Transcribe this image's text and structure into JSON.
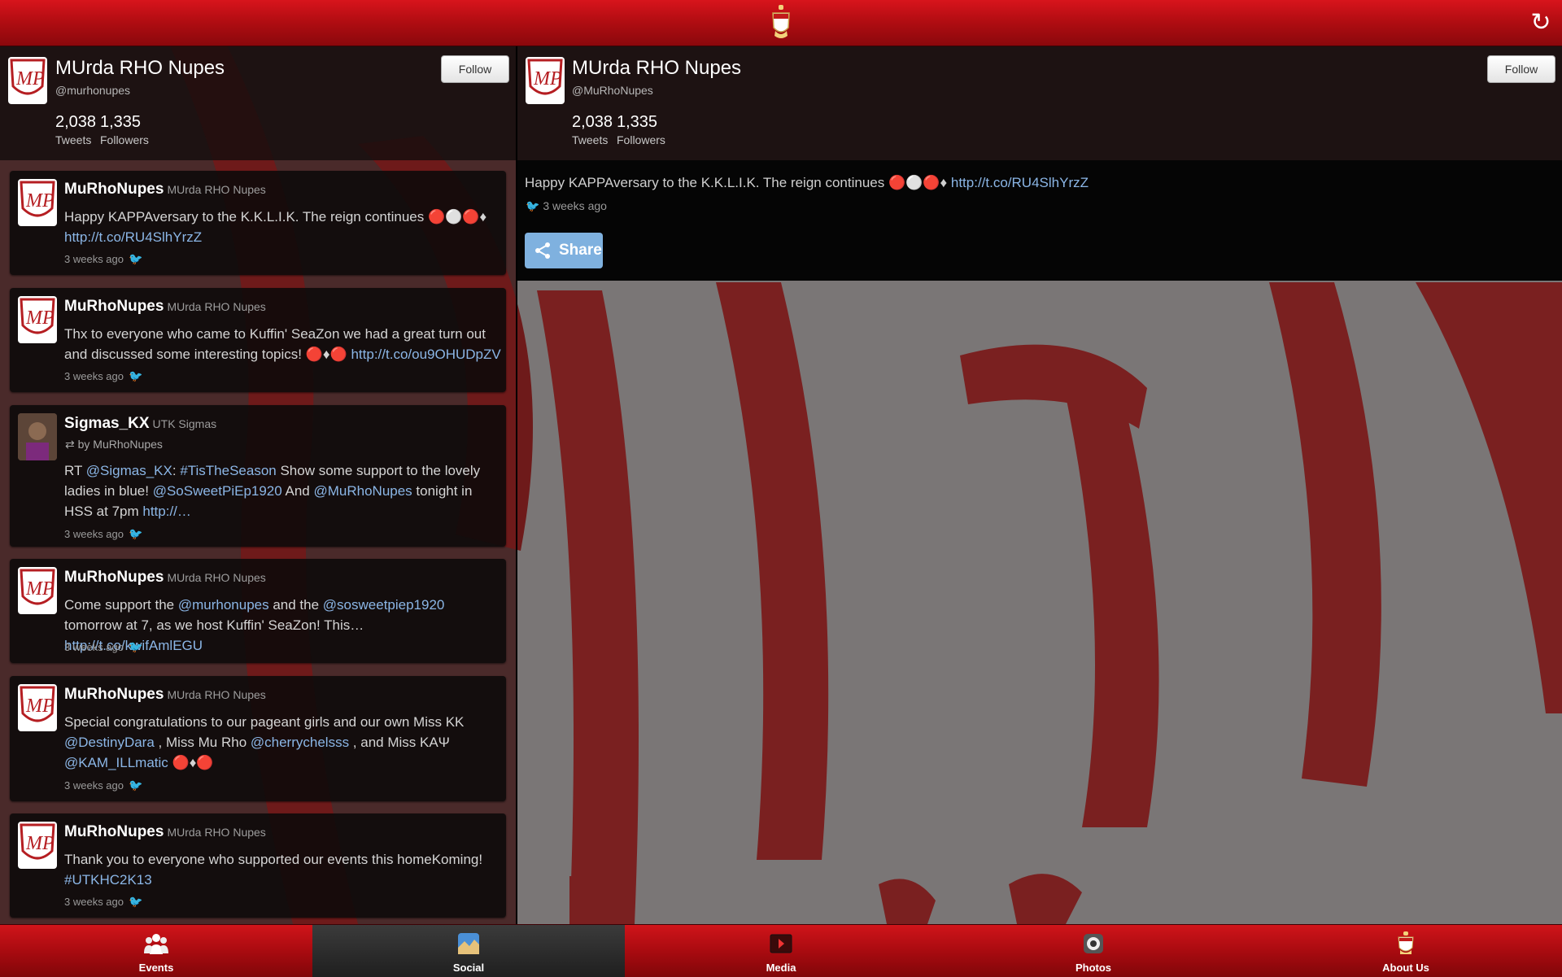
{
  "app": {
    "colors": {
      "primary": "#b30d12",
      "link": "#8bb6e6",
      "share": "#7fb1df"
    }
  },
  "topbar": {
    "logo_icon": "crest-logo-icon",
    "refresh_icon": "refresh-icon",
    "refresh_glyph": "↻"
  },
  "left_profile": {
    "name": "MUrda RHO Nupes",
    "handle": "@murhonupes",
    "tweets_count": "2,038",
    "tweets_label": "Tweets",
    "followers_count": "1,335",
    "followers_label": "Followers",
    "follow_label": "Follow"
  },
  "right_profile": {
    "name": "MUrda RHO Nupes",
    "handle": "@MuRhoNupes",
    "tweets_count": "2,038",
    "tweets_label": "Tweets",
    "followers_count": "1,335",
    "followers_label": "Followers",
    "follow_label": "Follow"
  },
  "tweets": [
    {
      "username": "MuRhoNupes",
      "display_name": "MUrda RHO Nupes",
      "text_before": "Happy KAPPAversary to the K.K.L.I.K. The reign continues 🔴⚪🔴♦",
      "link": "http://t.co/RU4SlhYrzZ",
      "text_after": "",
      "time": "3 weeks ago"
    },
    {
      "username": "MuRhoNupes",
      "display_name": "MUrda RHO Nupes",
      "text_before": "Thx to everyone who came to Kuffin' SeaZon we had a great turn out and discussed some interesting topics! 🔴♦🔴",
      "link": "http://t.co/ou9OHUDpZV",
      "text_after": "",
      "time": "3 weeks ago"
    },
    {
      "username": "Sigmas_KX",
      "display_name": "UTK Sigmas",
      "retweeted_by": "by MuRhoNupes",
      "text_parts": [
        {
          "t": "RT ",
          "link": false
        },
        {
          "t": "@Sigmas_KX",
          "link": true
        },
        {
          "t": ": ",
          "link": false
        },
        {
          "t": "#TisTheSeason",
          "link": true
        },
        {
          "t": " Show some support to the lovely ladies in blue! ",
          "link": false
        },
        {
          "t": "@SoSweetPiEp1920",
          "link": true
        },
        {
          "t": " And ",
          "link": false
        },
        {
          "t": "@MuRhoNupes",
          "link": true
        },
        {
          "t": " tonight in HSS at 7pm ",
          "link": false
        },
        {
          "t": "http://…",
          "link": true
        }
      ],
      "time": "3 weeks ago"
    },
    {
      "username": "MuRhoNupes",
      "display_name": "MUrda RHO Nupes",
      "text_parts": [
        {
          "t": "Come support the ",
          "link": false
        },
        {
          "t": "@murhonupes",
          "link": true
        },
        {
          "t": " and the ",
          "link": false
        },
        {
          "t": "@sosweetpiep1920",
          "link": true
        },
        {
          "t": " tomorrow at 7, as we host Kuffin' SeaZon! This… ",
          "link": false
        },
        {
          "t": "http://t.co/kwifAmlEGU",
          "link": true
        }
      ],
      "time": "3 weeks ago"
    },
    {
      "username": "MuRhoNupes",
      "display_name": "MUrda RHO Nupes",
      "text_parts": [
        {
          "t": "Special congratulations to our pageant girls and our own Miss KK ",
          "link": false
        },
        {
          "t": "@DestinyDara",
          "link": true
        },
        {
          "t": " , Miss Mu Rho ",
          "link": false
        },
        {
          "t": "@cherrychelsss",
          "link": true
        },
        {
          "t": " , and Miss KAΨ ",
          "link": false
        },
        {
          "t": "@KAM_ILLmatic",
          "link": true
        },
        {
          "t": " 🔴♦🔴",
          "link": false
        }
      ],
      "time": "3 weeks ago"
    },
    {
      "username": "MuRhoNupes",
      "display_name": "MUrda RHO Nupes",
      "text_parts": [
        {
          "t": "Thank you to everyone who supported our events this homeKoming! ",
          "link": false
        },
        {
          "t": "#UTKHC2K13",
          "link": true
        }
      ],
      "time": "3 weeks ago"
    }
  ],
  "detail": {
    "text": "Happy KAPPAversary to the K.K.L.I.K. The reign continues 🔴⚪🔴♦ ",
    "link": "http://t.co/RU4SlhYrzZ",
    "time": "3 weeks ago",
    "share_label": "Share"
  },
  "bottom_nav": [
    {
      "label": "Events",
      "icon": "people-icon",
      "active": false
    },
    {
      "label": "Social",
      "icon": "social-icon",
      "active": true
    },
    {
      "label": "Media",
      "icon": "media-icon",
      "active": false
    },
    {
      "label": "Photos",
      "icon": "camera-icon",
      "active": false
    },
    {
      "label": "About Us",
      "icon": "crest-icon",
      "active": false
    }
  ]
}
